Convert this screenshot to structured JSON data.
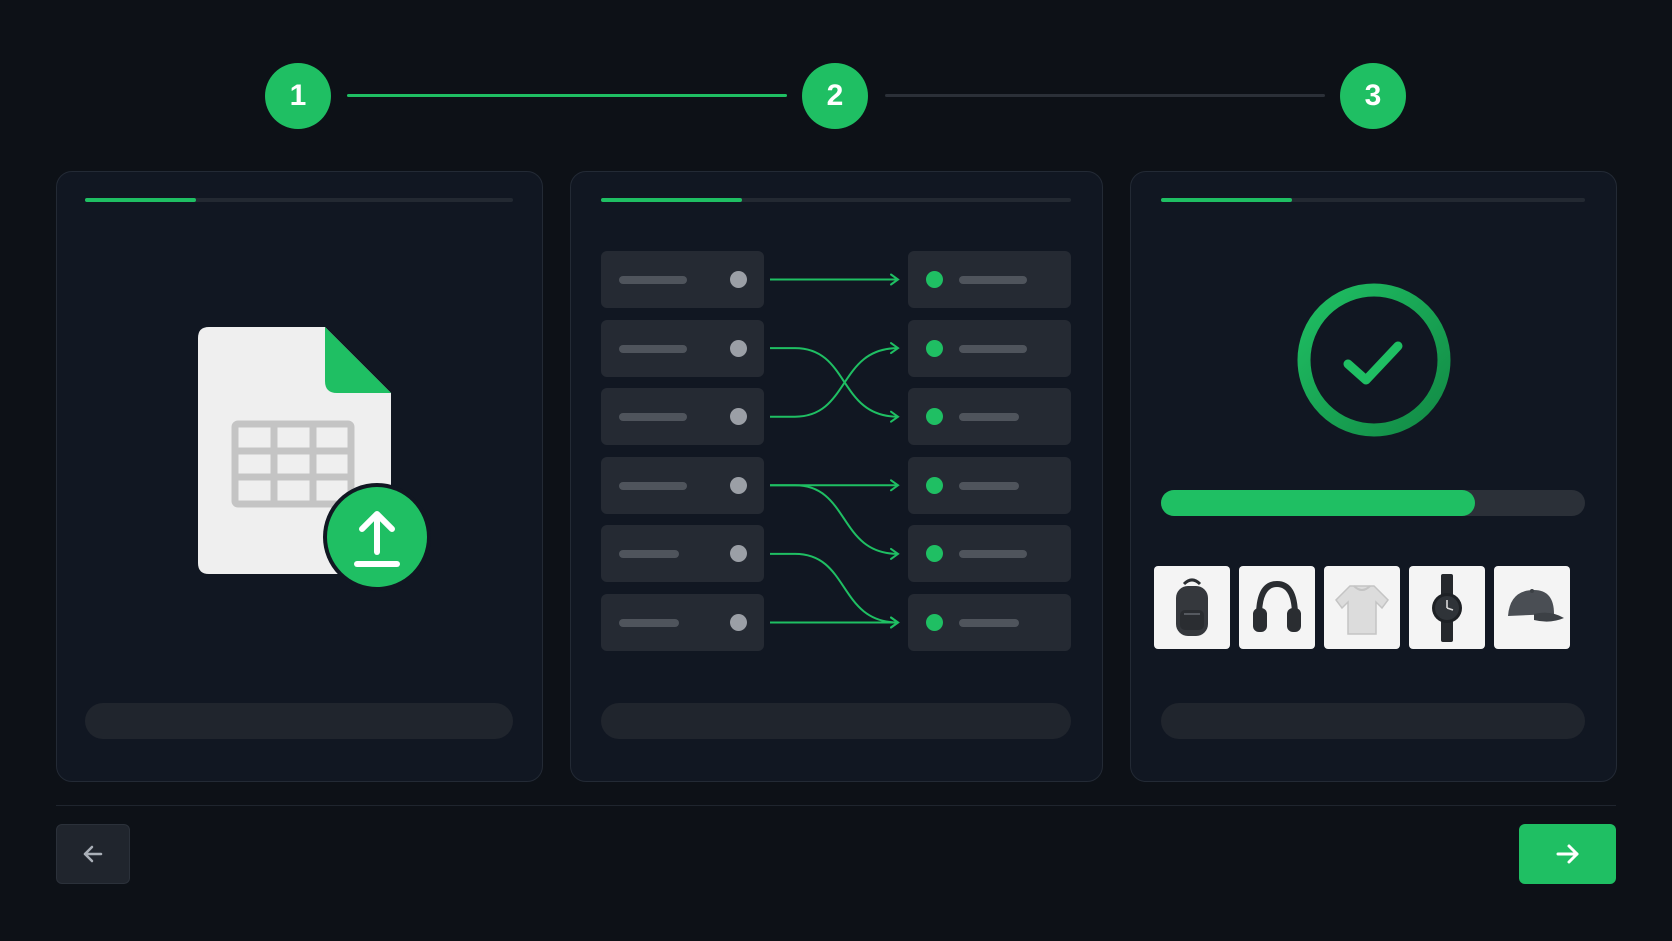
{
  "stepper": {
    "steps": [
      {
        "number": "1",
        "status": "complete"
      },
      {
        "number": "2",
        "status": "complete"
      },
      {
        "number": "3",
        "status": "current"
      }
    ],
    "connectors": [
      {
        "from": "1",
        "to": "2",
        "status": "complete"
      },
      {
        "from": "2",
        "to": "3",
        "status": "incomplete"
      }
    ]
  },
  "panels": [
    {
      "name": "upload",
      "progress": 0.26,
      "icon": "spreadsheet-upload-icon"
    },
    {
      "name": "mapping",
      "progress": 0.3,
      "rows": 6,
      "connections": [
        [
          0,
          0
        ],
        [
          1,
          2
        ],
        [
          2,
          1
        ],
        [
          3,
          3
        ],
        [
          3,
          4
        ],
        [
          4,
          5
        ],
        [
          5,
          5
        ]
      ]
    },
    {
      "name": "complete",
      "progress": 0.31,
      "icon": "check-circle-icon",
      "result_progress": 0.74,
      "products": [
        "backpack",
        "headphones",
        "sweater",
        "watch",
        "cap"
      ]
    }
  ],
  "navigation": {
    "back_icon": "arrow-left-icon",
    "next_icon": "arrow-right-icon"
  },
  "colors": {
    "accent": "#1fbf63",
    "background": "#0d1117",
    "panel": "#111722",
    "inactive": "#2b3038"
  }
}
